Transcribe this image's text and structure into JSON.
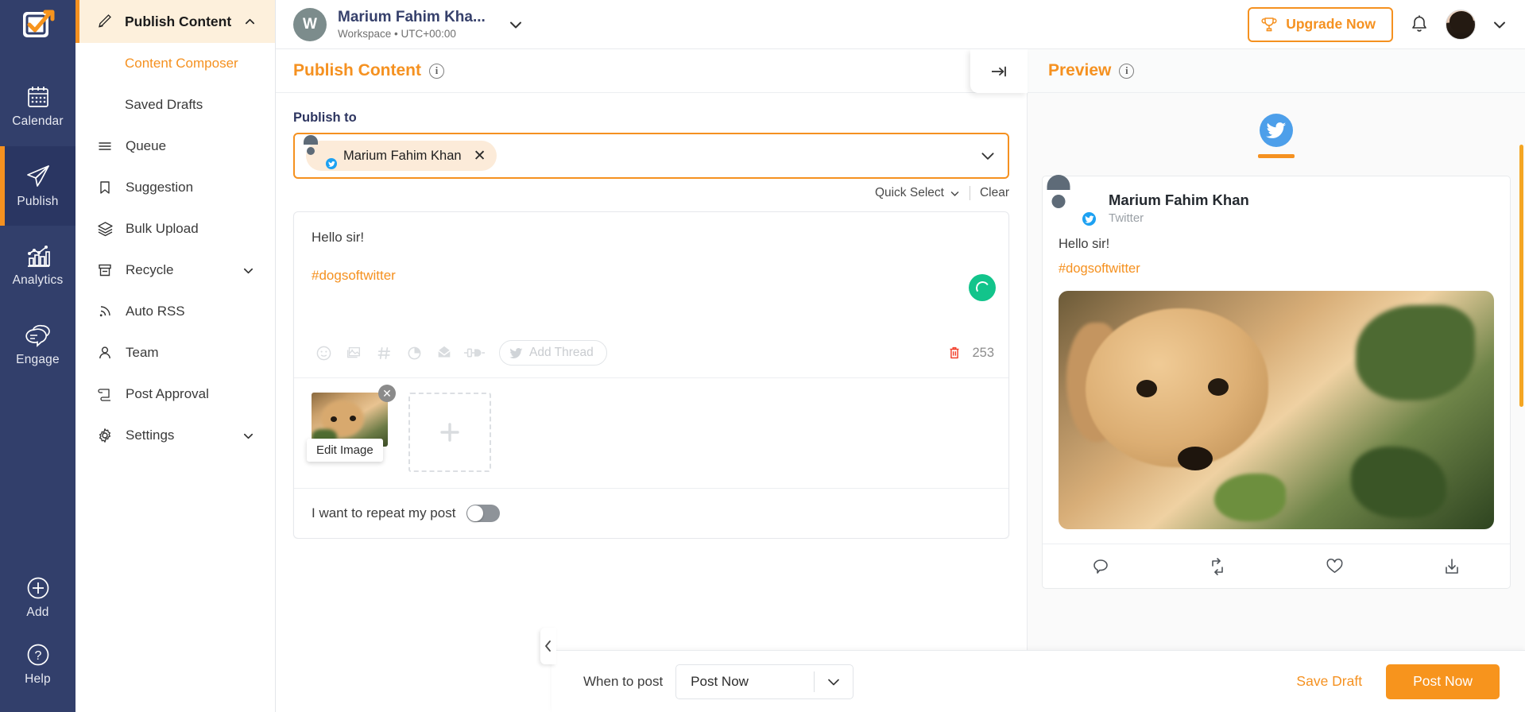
{
  "brand": {
    "accent": "#f59120",
    "rail_bg": "#323f6b",
    "twitter_blue": "#1da1f2"
  },
  "topbar": {
    "workspace_initial": "W",
    "workspace_name": "Marium Fahim Kha...",
    "workspace_sub": "Workspace • UTC+00:00",
    "upgrade_label": "Upgrade Now"
  },
  "rail": {
    "items": [
      {
        "label": "Calendar",
        "icon": "calendar-icon",
        "active": false
      },
      {
        "label": "Publish",
        "icon": "paper-plane-icon",
        "active": true
      },
      {
        "label": "Analytics",
        "icon": "bar-chart-icon",
        "active": false
      },
      {
        "label": "Engage",
        "icon": "chat-bubbles-icon",
        "active": false
      }
    ],
    "bottom": [
      {
        "label": "Add",
        "icon": "plus-circle-icon"
      },
      {
        "label": "Help",
        "icon": "question-circle-icon"
      }
    ]
  },
  "subnav": {
    "header": {
      "label": "Publish Content",
      "icon": "pencil-icon",
      "chevron": "chevron-up-icon"
    },
    "items": [
      {
        "label": "Content Composer",
        "current": true,
        "indent": true
      },
      {
        "label": "Saved Drafts",
        "current": false,
        "indent": true
      },
      {
        "label": "Queue",
        "icon": "list-icon"
      },
      {
        "label": "Suggestion",
        "icon": "bookmark-icon"
      },
      {
        "label": "Bulk Upload",
        "icon": "layers-icon"
      },
      {
        "label": "Recycle",
        "icon": "archive-icon",
        "chevron": true
      },
      {
        "label": "Auto RSS",
        "icon": "rss-icon"
      },
      {
        "label": "Team",
        "icon": "user-icon"
      },
      {
        "label": "Post Approval",
        "icon": "scroll-icon"
      },
      {
        "label": "Settings",
        "icon": "gear-icon",
        "chevron": true
      }
    ]
  },
  "composer": {
    "panel_title": "Publish Content",
    "publish_to_label": "Publish to",
    "selected_account": "Marium Fahim Khan",
    "quick_select_label": "Quick Select",
    "clear_label": "Clear",
    "editor_text": "Hello sir!",
    "editor_hashtag": "#dogsoftwitter",
    "add_thread_label": "Add Thread",
    "char_count": "253",
    "toolbar_icons": [
      "emoji-icon",
      "image-icon",
      "hashtag-icon",
      "poll-icon",
      "envelope-icon",
      "plug-icon"
    ],
    "edit_image_label": "Edit Image",
    "repeat_label": "I want to repeat my post",
    "repeat_enabled": false
  },
  "preview": {
    "panel_title": "Preview",
    "network": "Twitter",
    "account_name": "Marium Fahim Khan",
    "account_network": "Twitter",
    "text": "Hello sir!",
    "hashtag": "#dogsoftwitter",
    "actions": [
      "reply-icon",
      "retweet-icon",
      "like-icon",
      "share-icon"
    ]
  },
  "bottombar": {
    "when_label": "When to post",
    "when_value": "Post Now",
    "save_draft_label": "Save Draft",
    "post_now_label": "Post Now"
  }
}
